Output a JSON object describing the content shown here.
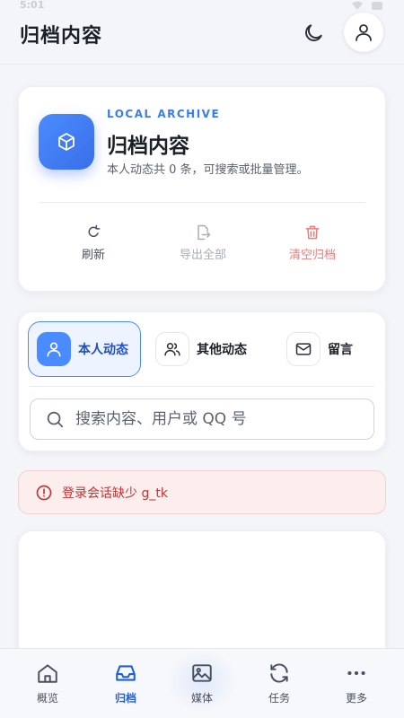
{
  "status_bar": {
    "time": "5:01"
  },
  "header": {
    "title": "归档内容"
  },
  "summary": {
    "eyebrow": "LOCAL ARCHIVE",
    "title": "归档内容",
    "description": "本人动态共 0 条，可搜索或批量管理。",
    "actions": {
      "refresh": "刷新",
      "export": "导出全部",
      "clear": "清空归档"
    }
  },
  "tabs": [
    {
      "label": "本人动态",
      "active": true
    },
    {
      "label": "其他动态",
      "active": false
    },
    {
      "label": "留言",
      "active": false
    }
  ],
  "search": {
    "placeholder": "搜索内容、用户或 QQ 号",
    "value": ""
  },
  "error": {
    "message": "登录会话缺少 g_tk"
  },
  "bottom_nav": [
    {
      "label": "概览",
      "icon": "home-icon",
      "active": false
    },
    {
      "label": "归档",
      "icon": "inbox-icon",
      "active": true
    },
    {
      "label": "媒体",
      "icon": "image-icon",
      "active": false
    },
    {
      "label": "任务",
      "icon": "sync-icon",
      "active": false
    },
    {
      "label": "更多",
      "icon": "more-icon",
      "active": false
    }
  ],
  "colors": {
    "accent": "#3b7cf0",
    "danger": "#c43333",
    "danger_bg": "#fdeeee",
    "muted": "#a9aeb8"
  }
}
